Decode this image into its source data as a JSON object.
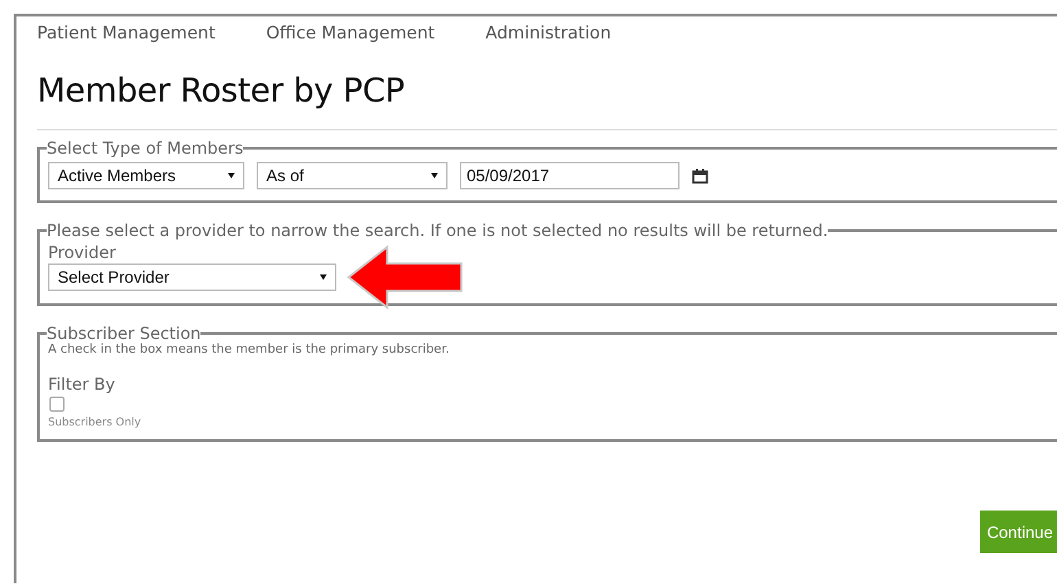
{
  "nav": [
    {
      "label": "Patient Management"
    },
    {
      "label": "Office Management"
    },
    {
      "label": "Administration"
    }
  ],
  "title": "Member Roster by PCP",
  "type_section": {
    "legend": "Select Type of Members",
    "member_type": {
      "value": "Active Members"
    },
    "date_mode": {
      "value": "As of"
    },
    "date": {
      "value": "05/09/2017"
    }
  },
  "provider_section": {
    "legend": "Please select a provider to narrow the search. If one is not selected no results will be returned.",
    "provider_label": "Provider",
    "provider": {
      "value": "Select Provider"
    }
  },
  "subscriber_section": {
    "legend": "Subscriber Section",
    "note": "A check in the box means the member is the primary subscriber.",
    "filter_label": "Filter By",
    "checkbox": {
      "label": "Subscribers Only",
      "checked": false
    }
  },
  "continue_button": "Continue"
}
